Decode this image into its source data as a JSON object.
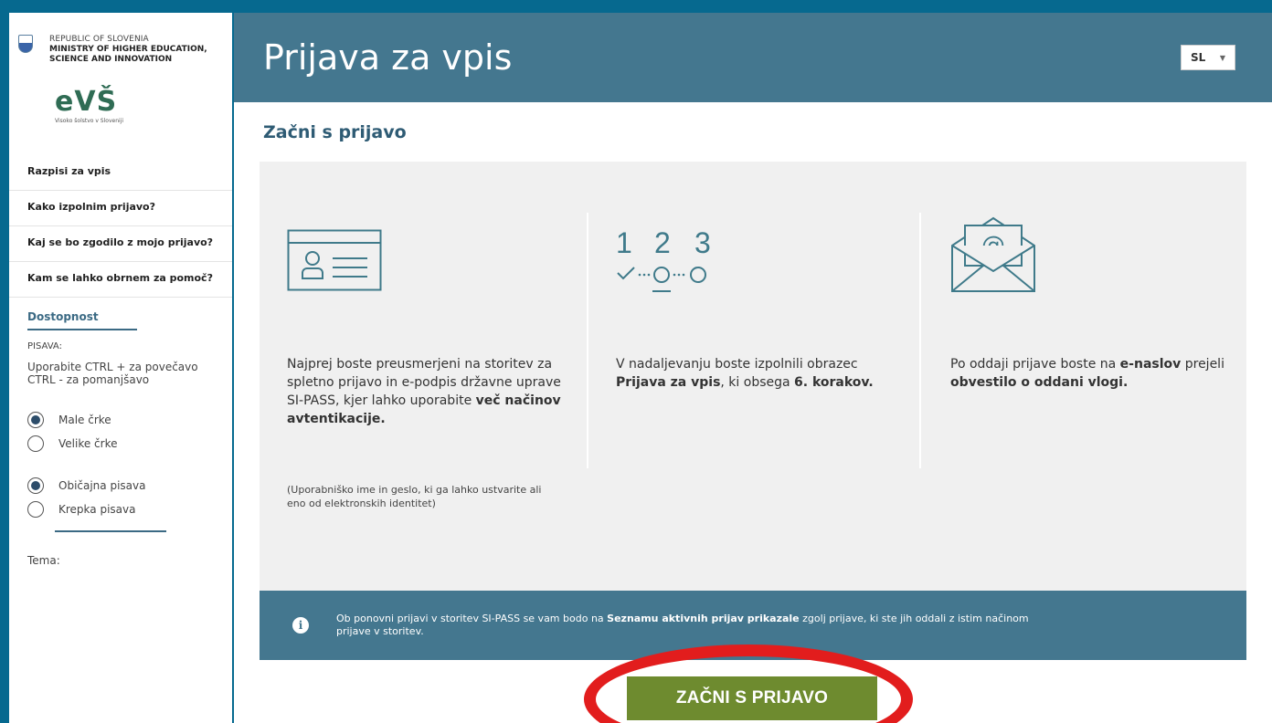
{
  "sidebar": {
    "ministry": {
      "line1": "REPUBLIC OF SLOVENIA",
      "line2": "MINISTRY OF HIGHER EDUCATION,",
      "line3": "SCIENCE AND INNOVATION"
    },
    "logo_text": "eVŠ",
    "logo_subtitle": "Visoko šolstvo v Sloveniji",
    "nav_items": [
      {
        "label": "Razpisi za vpis"
      },
      {
        "label": "Kako izpolnim prijavo?"
      },
      {
        "label": "Kaj se bo zgodilo z mojo prijavo?"
      },
      {
        "label": "Kam se lahko obrnem za pomoč?"
      }
    ],
    "accessibility": {
      "title": "Dostopnost",
      "font_label": "PISAVA:",
      "font_help": "Uporabite CTRL + za povečavo CTRL - za pomanjšavo",
      "case_options": [
        {
          "label": "Male črke",
          "selected": true
        },
        {
          "label": "Velike črke",
          "selected": false
        }
      ],
      "weight_options": [
        {
          "label": "Običajna pisava",
          "selected": true
        },
        {
          "label": "Krepka pisava",
          "selected": false
        }
      ],
      "theme_label": "Tema:"
    }
  },
  "header": {
    "title": "Prijava za vpis",
    "language": "SL"
  },
  "main": {
    "section_title": "Začni s prijavo",
    "steps": [
      {
        "icon": "id-card-icon",
        "text_before": "Najprej boste preusmerjeni na storitev za spletno prijavo in e-podpis državne uprave SI-PASS, kjer lahko uporabite ",
        "text_bold": "več načinov avtentikacije.",
        "note": "(Uporabniško ime in geslo, ki ga lahko ustvarite ali eno od elektronskih identitet)"
      },
      {
        "icon": "numbered-steps-icon",
        "icon_numbers": [
          "1",
          "2",
          "3"
        ],
        "text_before": "V nadaljevanju boste izpolnili obrazec ",
        "text_bold": "Prijava za vpis",
        "text_middle": ", ki obsega ",
        "text_bold2": "6. korakov."
      },
      {
        "icon": "envelope-at-icon",
        "text_before": "Po oddaji prijave boste na ",
        "text_bold": "e-naslov",
        "text_middle": " prejeli ",
        "text_bold2": "obvestilo o oddani vlogi."
      }
    ],
    "info": {
      "text_before": "Ob ponovni prijavi v storitev SI-PASS se vam bodo na ",
      "text_bold": "Seznamu aktivnih prijav prikazale",
      "text_after": " zgolj prijave, ki ste jih oddali z istim načinom prijave v storitev."
    },
    "start_button": "ZAČNI S PRIJAVO"
  },
  "colors": {
    "page_background": "#06698f",
    "header_background": "#44778f",
    "panel_background": "#f0f0f0",
    "button_green": "#6e8b2f",
    "highlight_ring": "#e21d1d",
    "icon_teal": "#3f7a8a"
  }
}
